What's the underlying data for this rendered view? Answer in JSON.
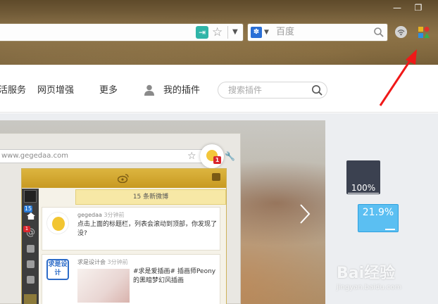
{
  "window": {
    "minimize_glyph": "—",
    "restore_glyph": "❐"
  },
  "toolbar": {
    "search_placeholder": "百度",
    "reader_icon": "reader-mode-icon",
    "star_icon": "bookmark-star-icon",
    "colors": {
      "chrome": "#7a633e",
      "reader": "#2fb5a8",
      "engine": "#2a6fd6"
    }
  },
  "navbar": {
    "items": [
      {
        "label": "活服务"
      },
      {
        "label": "网页增强"
      },
      {
        "label": "更多"
      }
    ],
    "my_plugins": "我的插件",
    "plugin_search_placeholder": "搜索插件"
  },
  "banner": {
    "mock_url": "www.gegedaa.com",
    "new_posts": "15 条新微博",
    "sidebar_badges": {
      "home": "15",
      "at": "1"
    },
    "posts": [
      {
        "user": "gegedaa",
        "time": "3分钟前",
        "text": "点击上面的标题栏，列表会滚动到顶部，你发现了没?"
      },
      {
        "user": "求是设计会",
        "time": "3分钟前",
        "text": "#求是爱插画# 插画师Peony的黑暗梦幻风插画",
        "logo_text": "求是设计"
      }
    ],
    "chick_badge": "1"
  },
  "tiles": [
    {
      "label": "100%",
      "color": "#3b4150"
    },
    {
      "label": "21.9%",
      "color": "#5bbff2"
    }
  ],
  "watermark": {
    "line1": "Bai经验",
    "line2": "jingyan.baidu.com"
  },
  "annotation": {
    "color": "#f01818"
  }
}
